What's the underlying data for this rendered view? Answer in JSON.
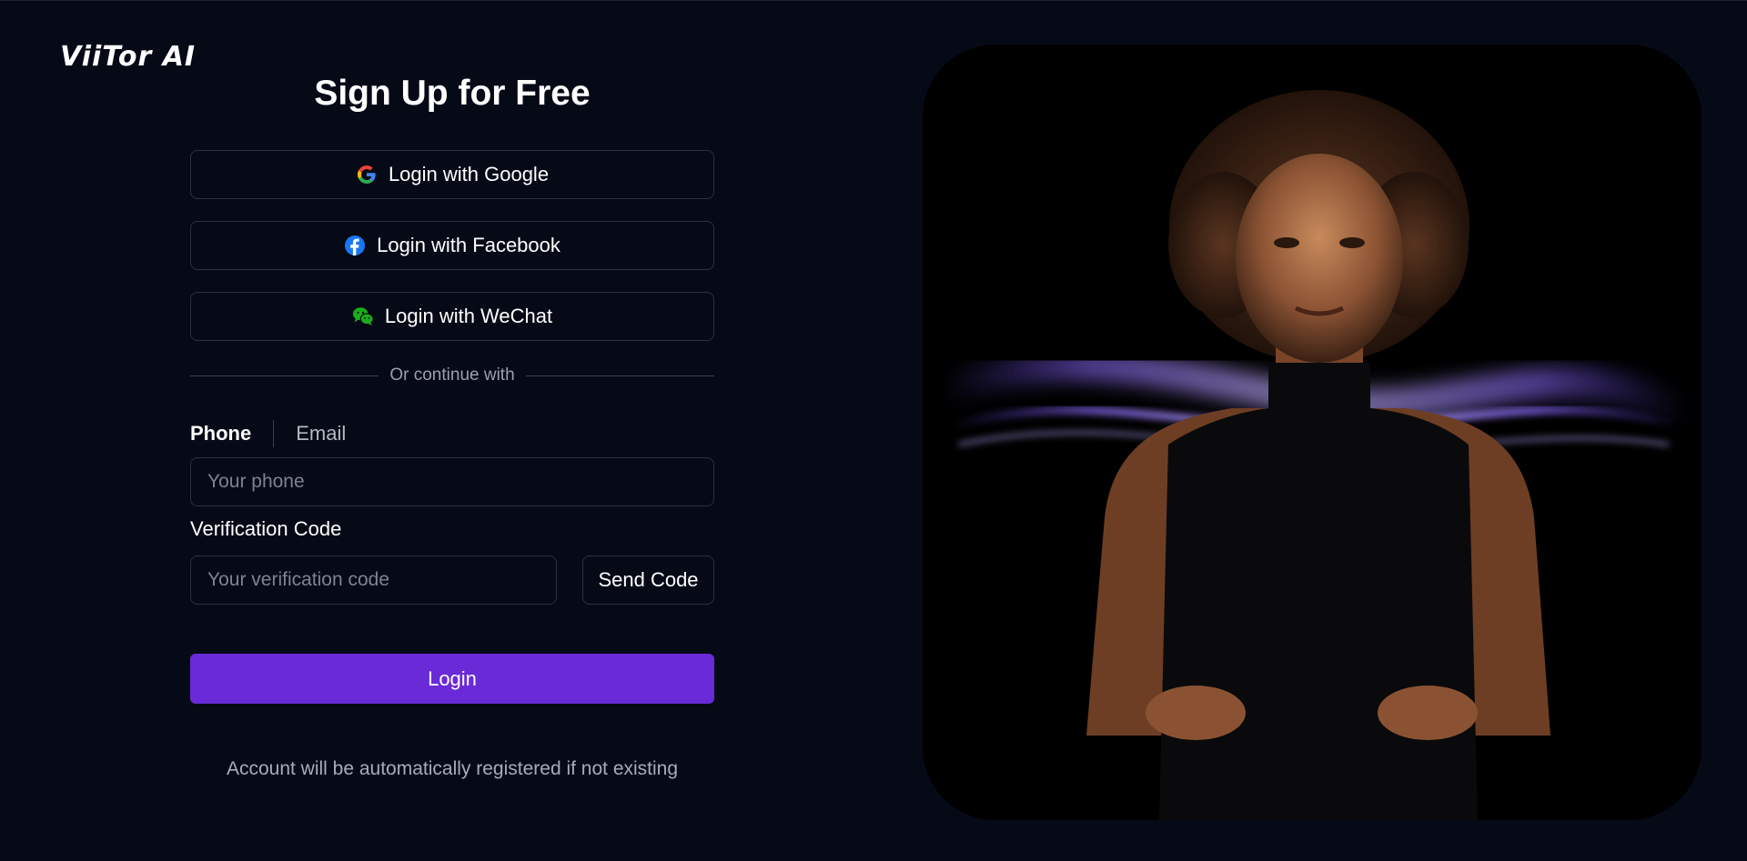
{
  "brand": {
    "logo_text": "ViiTor AI"
  },
  "form": {
    "title": "Sign Up for Free",
    "social": {
      "google_label": "Login with Google",
      "facebook_label": "Login with Facebook",
      "wechat_label": "Login with WeChat"
    },
    "divider_text": "Or continue with",
    "tabs": {
      "phone": "Phone",
      "email": "Email",
      "active": "phone"
    },
    "phone_placeholder": "Your phone",
    "phone_value": "",
    "code_label": "Verification Code",
    "code_placeholder": "Your verification code",
    "code_value": "",
    "send_code_label": "Send Code",
    "login_label": "Login",
    "note": "Account will be automatically registered if not existing"
  },
  "colors": {
    "background": "#060a16",
    "accent": "#6a2ad8",
    "border": "#2a3142"
  },
  "icons": {
    "google": "google-icon",
    "facebook": "facebook-icon",
    "wechat": "wechat-icon"
  }
}
